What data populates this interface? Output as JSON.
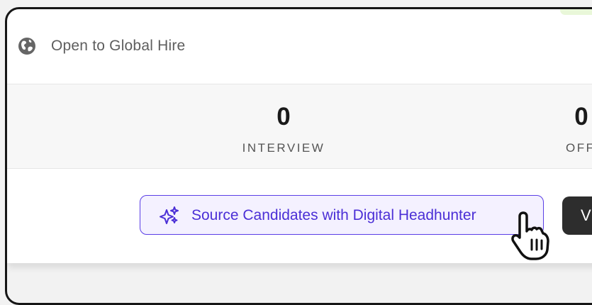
{
  "global_hire": {
    "icon": "globe-icon",
    "label": "Open to Global Hire"
  },
  "stats": [
    {
      "value": "0",
      "label": "INTERVIEW"
    },
    {
      "value": "0",
      "label": "OFF"
    }
  ],
  "actions": {
    "source_button": {
      "icon": "sparkle-icon",
      "label": "Source Candidates with Digital Headhunter"
    },
    "dark_button": {
      "label": "V"
    }
  },
  "colors": {
    "accent_purple": "#5a3ee6",
    "accent_purple_bg": "#f4f1ff",
    "dark_button": "#2d2d2d",
    "frame_border": "#161616"
  }
}
